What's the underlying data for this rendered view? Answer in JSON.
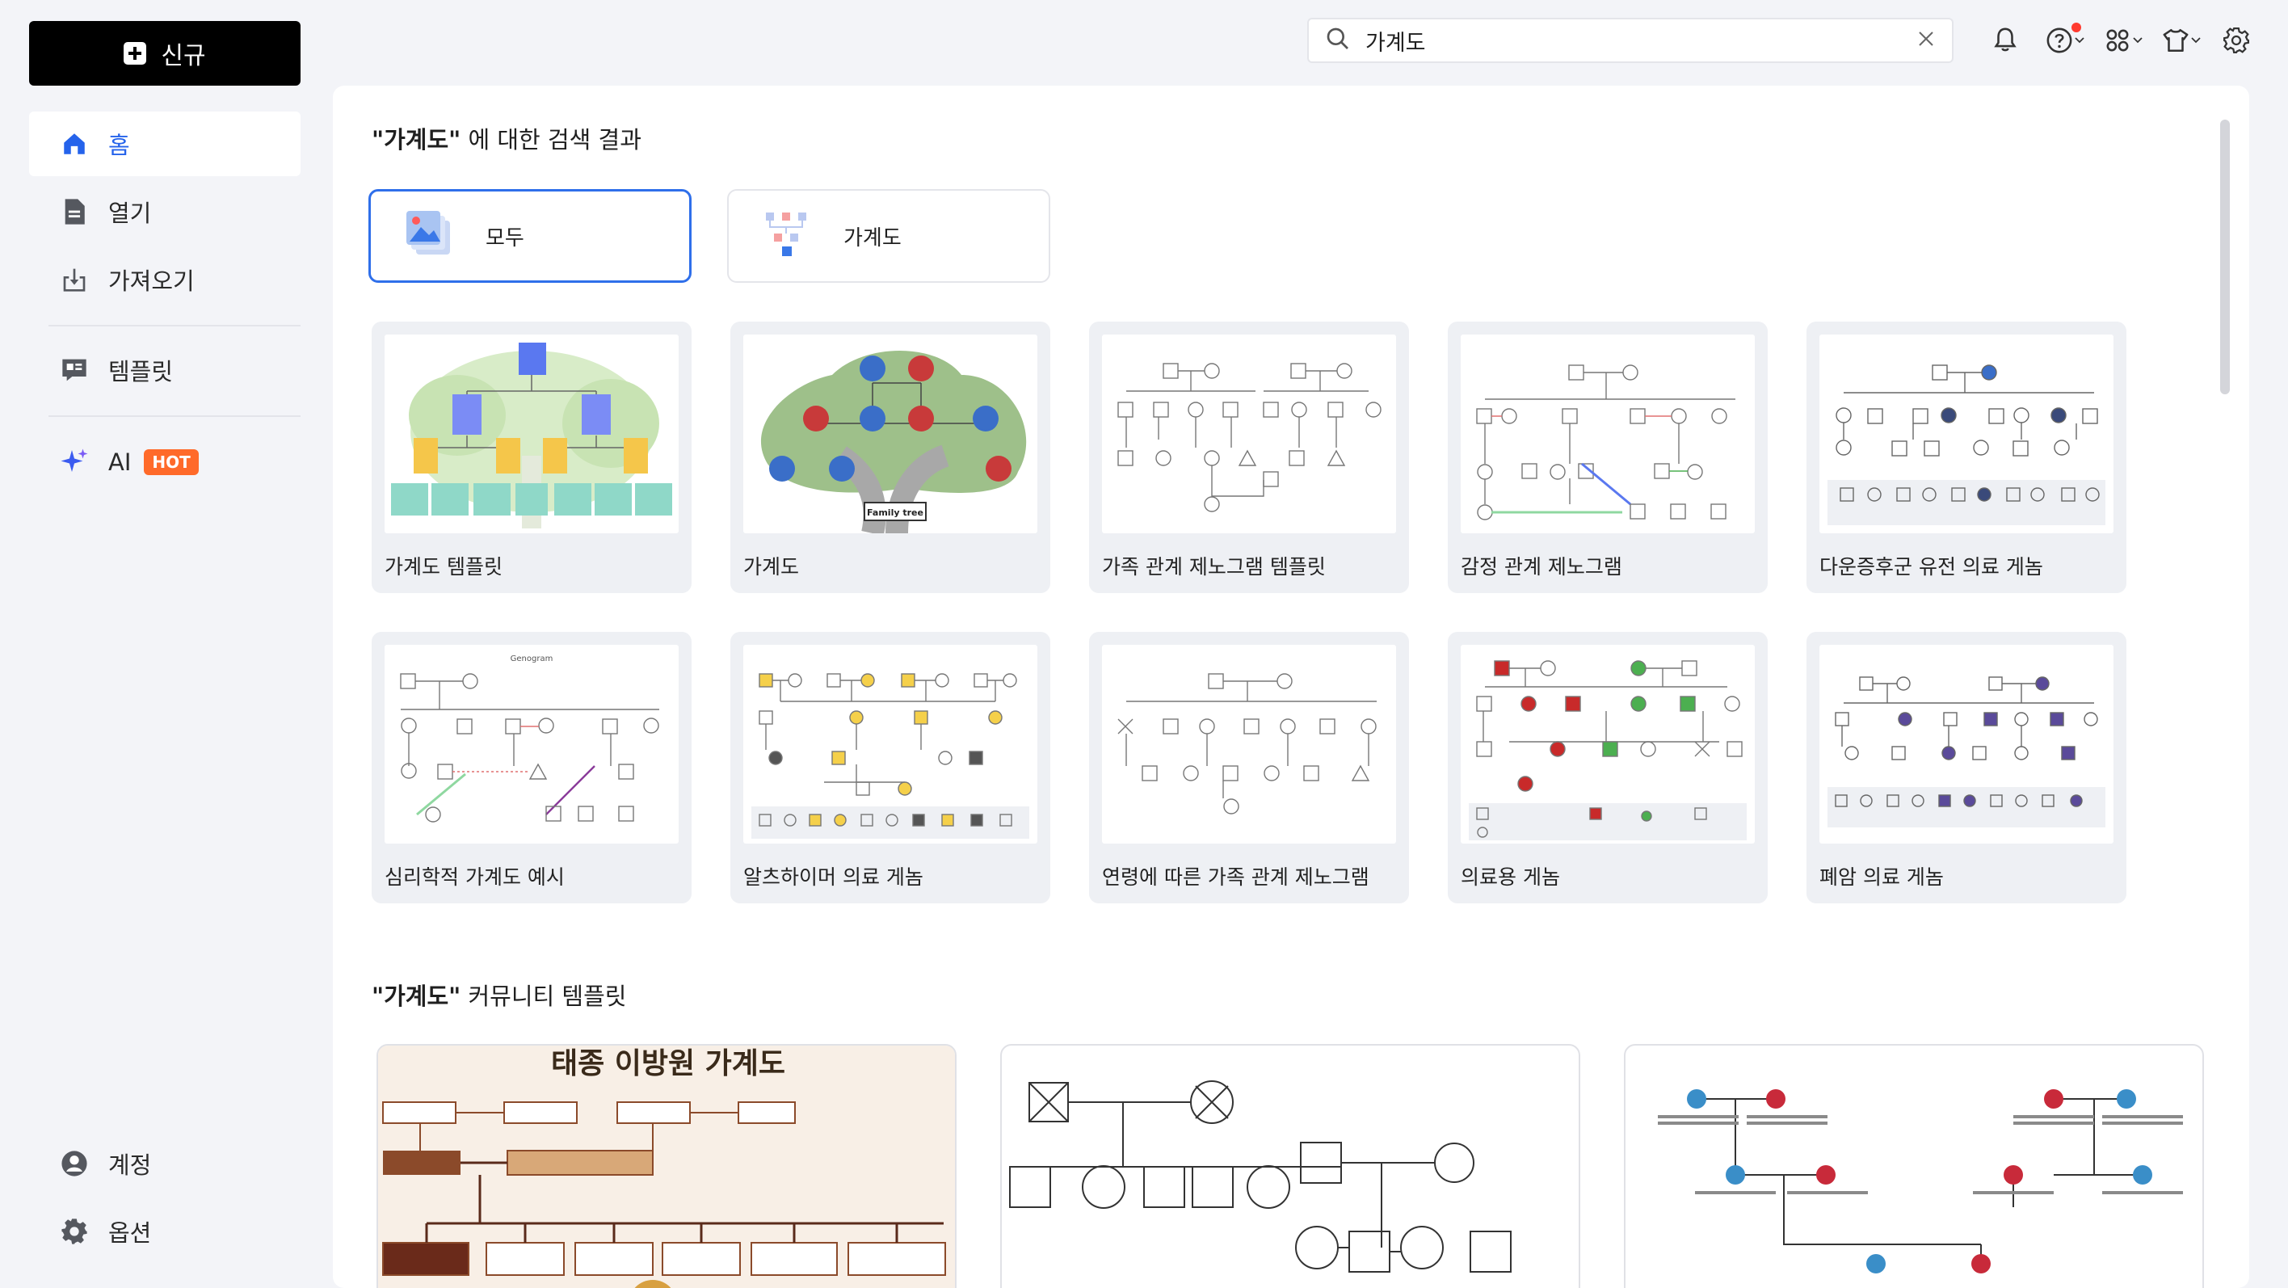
{
  "sidebar": {
    "new_label": "신규",
    "items": [
      {
        "label": "홈",
        "icon": "home-icon"
      },
      {
        "label": "열기",
        "icon": "file-icon"
      },
      {
        "label": "가져오기",
        "icon": "import-icon"
      },
      {
        "label": "템플릿",
        "icon": "template-icon"
      },
      {
        "label": "AI",
        "icon": "sparkle-icon",
        "badge": "HOT"
      }
    ],
    "bottom": [
      {
        "label": "계정",
        "icon": "account-icon"
      },
      {
        "label": "옵션",
        "icon": "gear-icon"
      }
    ]
  },
  "search": {
    "value": "가계도"
  },
  "results": {
    "title_query": "\"가계도\"",
    "title_suffix": " 에 대한 검색 결과",
    "filters": [
      {
        "label": "모두",
        "selected": true
      },
      {
        "label": "가계도",
        "selected": false
      }
    ],
    "templates": [
      {
        "label": "가계도 템플릿"
      },
      {
        "label": "가계도",
        "thumb_text": "Family tree"
      },
      {
        "label": "가족 관계 제노그램 템플릿"
      },
      {
        "label": "감정 관계 제노그램"
      },
      {
        "label": "다운증후군 유전 의료 게놈"
      },
      {
        "label": "심리학적 가계도 예시",
        "thumb_text": "Genogram"
      },
      {
        "label": "알츠하이머 의료 게놈"
      },
      {
        "label": "연령에 따른 가족 관계 제노그램"
      },
      {
        "label": "의료용 게놈"
      },
      {
        "label": "폐암 의료 게놈"
      }
    ]
  },
  "community": {
    "title_query": "\"가계도\"",
    "title_suffix": " 커뮤니티 템플릿",
    "cards": [
      {
        "thumb_title": "태종 이방원 가계도"
      },
      {
        "thumb_title": ""
      },
      {
        "thumb_title": ""
      }
    ]
  },
  "colors": {
    "accent": "#2563eb",
    "selected_border": "#2f6fea",
    "hot": "#ff6a2a",
    "card_bg": "#eef0f4",
    "page_bg": "#f3f4f8"
  }
}
